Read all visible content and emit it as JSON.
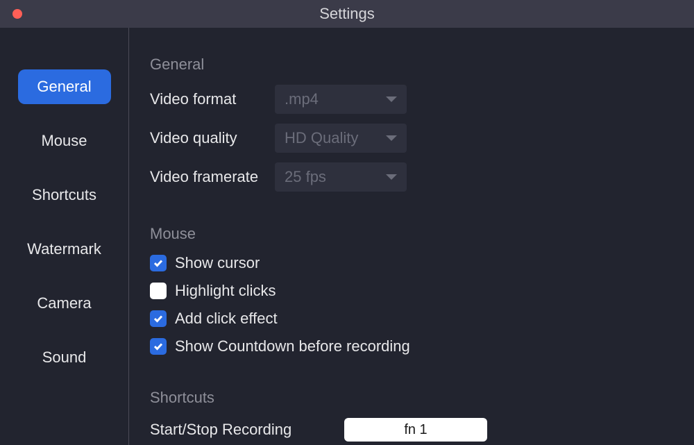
{
  "window": {
    "title": "Settings"
  },
  "sidebar": {
    "items": [
      {
        "label": "General",
        "active": true
      },
      {
        "label": "Mouse",
        "active": false
      },
      {
        "label": "Shortcuts",
        "active": false
      },
      {
        "label": "Watermark",
        "active": false
      },
      {
        "label": "Camera",
        "active": false
      },
      {
        "label": "Sound",
        "active": false
      }
    ]
  },
  "sections": {
    "general": {
      "header": "General",
      "rows": {
        "video_format": {
          "label": "Video format",
          "value": ".mp4"
        },
        "video_quality": {
          "label": "Video quality",
          "value": "HD Quality"
        },
        "video_framerate": {
          "label": "Video framerate",
          "value": "25 fps"
        }
      }
    },
    "mouse": {
      "header": "Mouse",
      "checkboxes": {
        "show_cursor": {
          "label": "Show cursor",
          "checked": true
        },
        "highlight_clicks": {
          "label": "Highlight clicks",
          "checked": false
        },
        "add_click_effect": {
          "label": "Add click effect",
          "checked": true
        },
        "show_countdown": {
          "label": "Show Countdown before recording",
          "checked": true
        }
      }
    },
    "shortcuts": {
      "header": "Shortcuts",
      "rows": {
        "start_stop": {
          "label": "Start/Stop Recording",
          "value": "fn 1"
        }
      }
    }
  }
}
